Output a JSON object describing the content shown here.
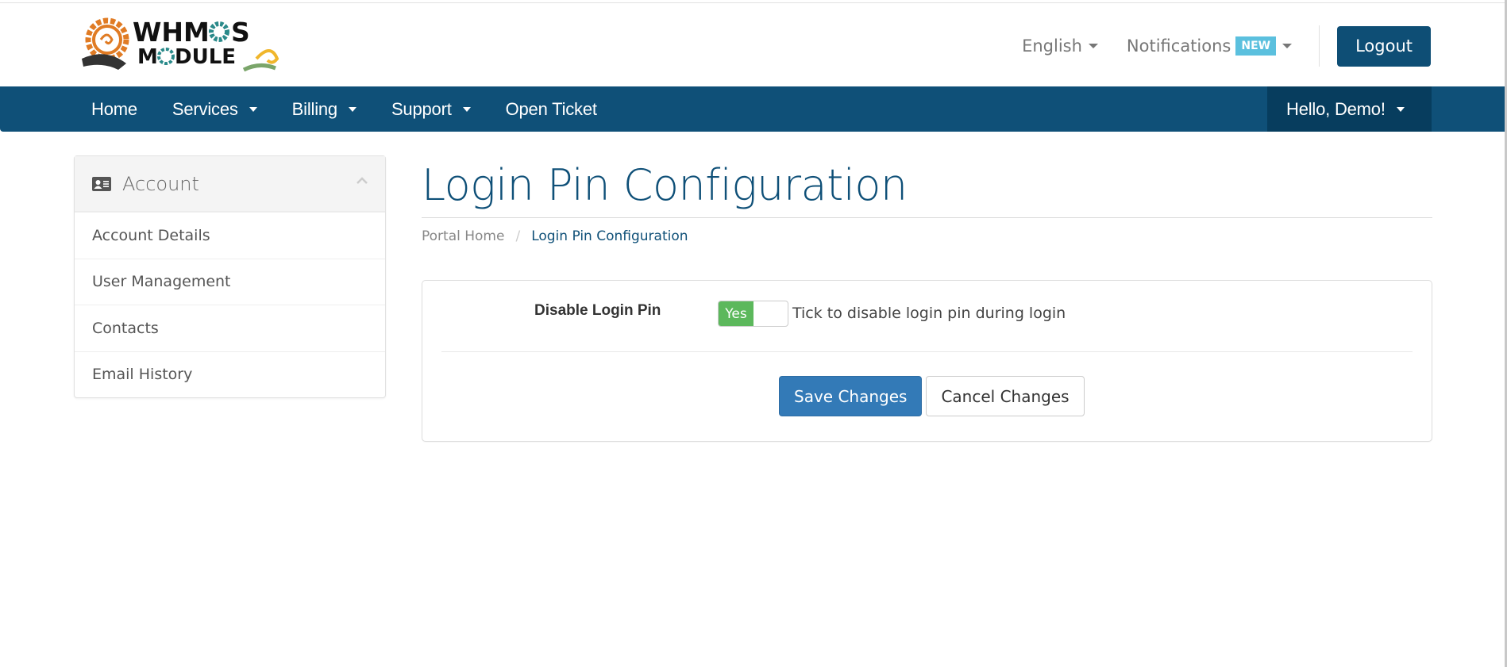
{
  "header": {
    "logo_alt": "WHMCS MODULE",
    "language_label": "English",
    "notifications_label": "Notifications",
    "notifications_badge": "NEW",
    "logout_label": "Logout"
  },
  "nav": {
    "items": [
      {
        "label": "Home",
        "has_dropdown": false
      },
      {
        "label": "Services",
        "has_dropdown": true
      },
      {
        "label": "Billing",
        "has_dropdown": true
      },
      {
        "label": "Support",
        "has_dropdown": true
      },
      {
        "label": "Open Ticket",
        "has_dropdown": false
      }
    ],
    "user_menu_label": "Hello, Demo!"
  },
  "sidebar": {
    "title": "Account",
    "title_icon": "id-card-icon",
    "collapse_icon": "chevron-up-icon",
    "items": [
      {
        "label": "Account Details"
      },
      {
        "label": "User Management"
      },
      {
        "label": "Contacts"
      },
      {
        "label": "Email History"
      }
    ]
  },
  "main": {
    "page_title": "Login Pin Configuration",
    "breadcrumb": {
      "home": "Portal Home",
      "separator": "/",
      "current": "Login Pin Configuration"
    },
    "form": {
      "field_label": "Disable Login Pin",
      "toggle_state_label": "Yes",
      "toggle_on": true,
      "help_text": "Tick to disable login pin during login",
      "save_label": "Save Changes",
      "cancel_label": "Cancel Changes"
    }
  },
  "colors": {
    "brand_primary": "#0f5078",
    "brand_dark": "#073d5e",
    "toggle_on": "#5cb85c",
    "save_button": "#337ab7",
    "badge_new": "#5bc0de"
  }
}
